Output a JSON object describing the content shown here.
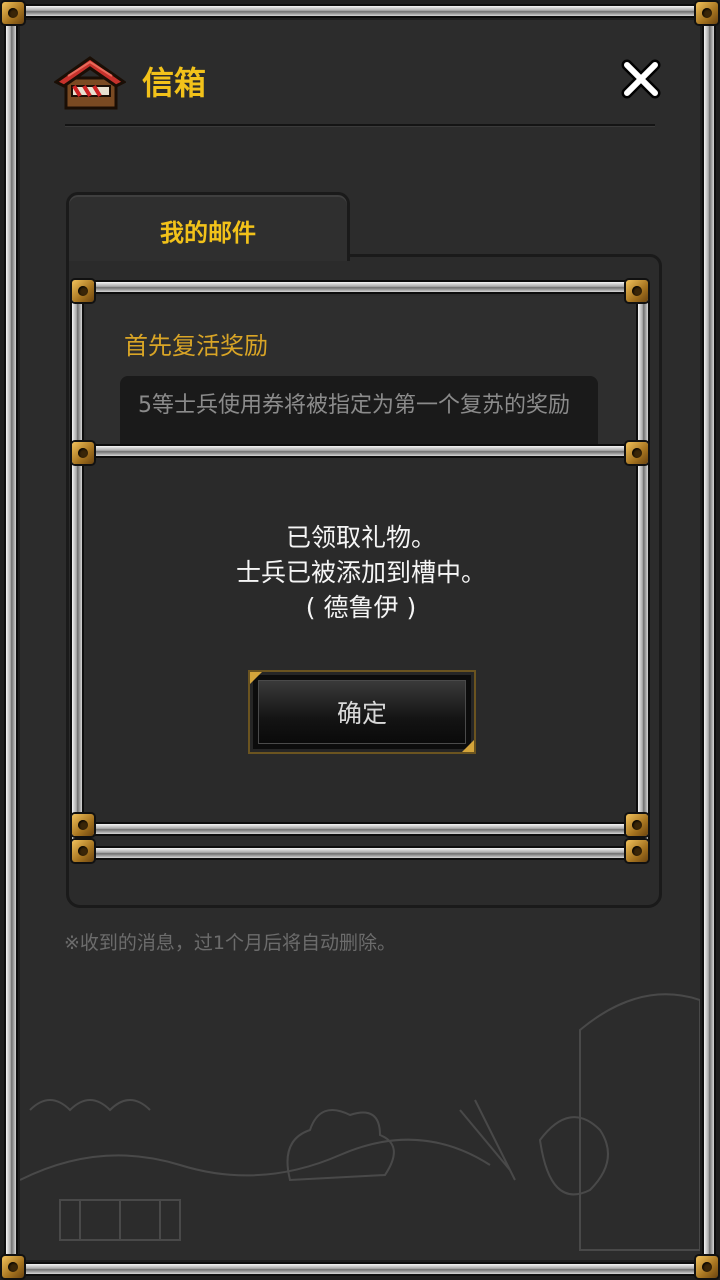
{
  "header": {
    "title": "信箱",
    "icon": "mailbox-house-icon",
    "close_icon": "close-icon"
  },
  "tabs": [
    {
      "label": "我的邮件",
      "active": true
    }
  ],
  "mail": {
    "title": "首先复活奖励",
    "body": "5等士兵使用券将被指定为第一个复苏的奖励"
  },
  "dialog": {
    "line1": "已领取礼物。",
    "line2": "士兵已被添加到槽中。",
    "line3": "( 德鲁伊 )",
    "ok_label": "确定"
  },
  "footer_note": "※收到的消息，过1个月后将自动删除。",
  "colors": {
    "accent": "#f2c21a",
    "mail_title": "#d9a526",
    "frame_bolt": "#b07a22"
  }
}
